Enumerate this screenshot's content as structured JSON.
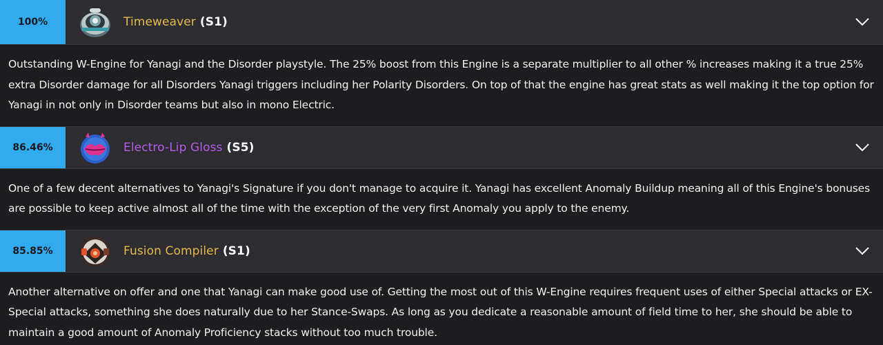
{
  "items": [
    {
      "percent": "100%",
      "name": "Timeweaver",
      "rank": "(S1)",
      "name_color": "#e5b94a",
      "icon": "timeweaver-engine-icon",
      "description": "Outstanding W-Engine for Yanagi and the Disorder playstyle. The 25% boost from this Engine is a separate multiplier to all other % increases making it a true 25% extra Disorder damage for all Disorders Yanagi triggers including her Polarity Disorders. On top of that the engine has great stats as well making it the top option for Yanagi in not only in Disorder teams but also in mono Electric."
    },
    {
      "percent": "86.46%",
      "name": "Electro-Lip Gloss",
      "rank": "(S5)",
      "name_color": "#b65be6",
      "icon": "electro-lip-gloss-engine-icon",
      "description": "One of a few decent alternatives to Yanagi's Signature if you don't manage to acquire it. Yanagi has excellent Anomaly Buildup meaning all of this Engine's bonuses are possible to keep active almost all of the time with the exception of the very first Anomaly you apply to the enemy."
    },
    {
      "percent": "85.85%",
      "name": "Fusion Compiler",
      "rank": "(S1)",
      "name_color": "#e5b94a",
      "icon": "fusion-compiler-engine-icon",
      "description": "Another alternative on offer and one that Yanagi can make good use of. Getting the most out of this W-Engine requires frequent uses of either Special attacks or EX-Special attacks, something she does naturally due to her Stance-Swaps. As long as you dedicate a reasonable amount of field time to her, she should be able to maintain a good amount of Anomaly Proficiency stacks without too much trouble."
    }
  ],
  "colors": {
    "accent": "#31aaf0",
    "header_bg": "#2c2c31",
    "body_bg": "#1d1d20"
  }
}
